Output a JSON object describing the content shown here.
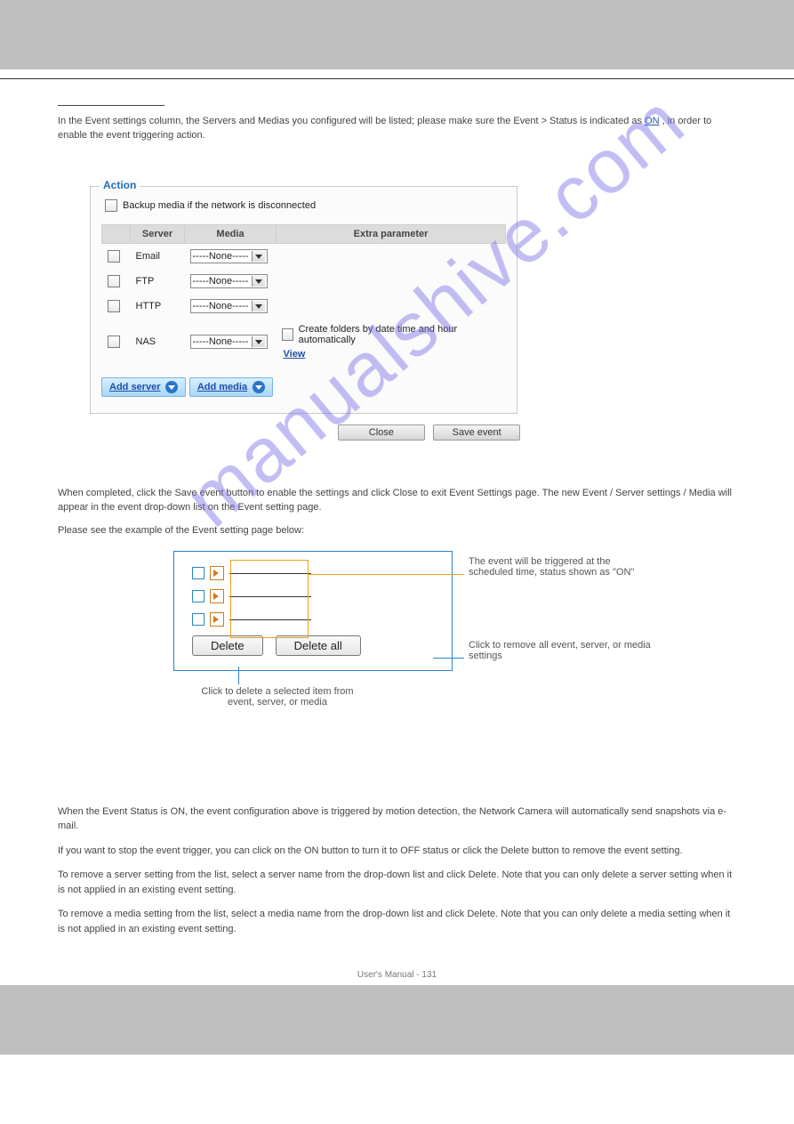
{
  "watermark": "manualshive.com",
  "footer": "User's Manual - 131",
  "pageno": "",
  "section": {
    "title": "",
    "intro_text_prefix": "In the Event settings column, the Servers and Medias you configured will be listed; please make sure the Event > Status is indicated as ",
    "intro_on": "ON",
    "intro_text_suffix": ", in order to enable the event triggering action."
  },
  "action_panel": {
    "legend": "Action",
    "backup_label": "Backup media if the network is disconnected",
    "headers": {
      "server": "Server",
      "media": "Media",
      "extra": "Extra parameter"
    },
    "rows": [
      {
        "label": "Email",
        "media": "-----None-----"
      },
      {
        "label": "FTP",
        "media": "-----None-----"
      },
      {
        "label": "HTTP",
        "media": "-----None-----"
      },
      {
        "label": "NAS",
        "media": "-----None-----"
      }
    ],
    "nas_create_label": "Create folders by date time and hour automatically",
    "view_label": "View",
    "add_server": "Add server",
    "add_media": "Add media",
    "close": "Close",
    "save": "Save event"
  },
  "nas_section": {
    "p1": "When completed, click the Save event button to enable the settings and click Close to exit Event Settings page. The new Event / Server settings / Media will appear in the event drop-down list on the Event setting page.",
    "p2": "Please see the example of the Event setting page below:",
    "delete": "Delete",
    "delete_all": "Delete all",
    "callout1": "The event will be triggered at the scheduled time, status shown as \"ON\"",
    "callout2": "Click to remove all event, server, or media settings",
    "callout3": "Click to delete a selected item from event, server, or media"
  },
  "tail": {
    "p1": "When the Event Status is ON, the event configuration above is triggered by motion detection, the Network Camera will automatically send snapshots via e-mail.",
    "p2": "If you want to stop the event trigger, you can click on the ON button to turn it to OFF status or click the Delete button to remove the event setting.",
    "p3": "To remove a server setting from the list, select a server name from the drop-down list and click Delete. Note that you can only delete a server setting when it is not applied in an existing event setting.",
    "p4": "To remove a media setting from the list, select a media name from the drop-down list and click Delete. Note that you can only delete a media setting when it is not applied in an existing event setting."
  }
}
